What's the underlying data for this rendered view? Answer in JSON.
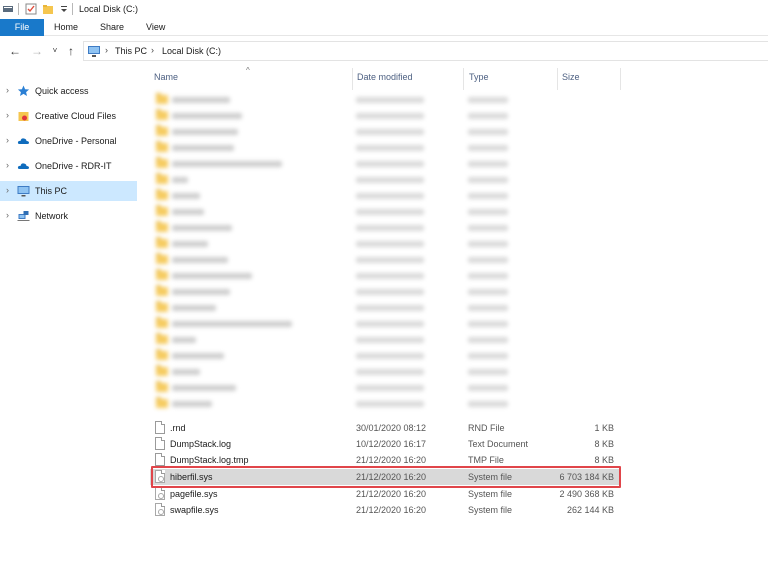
{
  "window": {
    "title": "Local Disk (C:)"
  },
  "ribbon": {
    "tabs": [
      "File",
      "Home",
      "Share",
      "View"
    ]
  },
  "address": {
    "segments": [
      "This PC",
      "Local Disk (C:)"
    ]
  },
  "sidebar": {
    "items": [
      {
        "label": "Quick access",
        "icon": "star-icon"
      },
      {
        "label": "Creative Cloud Files",
        "icon": "creative-cloud-folder-icon"
      },
      {
        "label": "OneDrive - Personal",
        "icon": "cloud-icon"
      },
      {
        "label": "OneDrive - RDR-IT",
        "icon": "cloud-icon"
      },
      {
        "label": "This PC",
        "icon": "computer-icon",
        "selected": true
      },
      {
        "label": "Network",
        "icon": "network-icon"
      }
    ]
  },
  "columns": {
    "name": "Name",
    "date": "Date modified",
    "type": "Type",
    "size": "Size"
  },
  "files": [
    {
      "name": ".rnd",
      "date": "30/01/2020 08:12",
      "type": "RND File",
      "size": "1 KB",
      "icon": "file-icon"
    },
    {
      "name": "DumpStack.log",
      "date": "10/12/2020 16:17",
      "type": "Text Document",
      "size": "8 KB",
      "icon": "file-icon"
    },
    {
      "name": "DumpStack.log.tmp",
      "date": "21/12/2020 16:20",
      "type": "TMP File",
      "size": "8 KB",
      "icon": "file-icon"
    },
    {
      "name": "hiberfil.sys",
      "date": "21/12/2020 16:20",
      "type": "System file",
      "size": "6 703 184 KB",
      "icon": "system-file-icon",
      "selected": true
    },
    {
      "name": "pagefile.sys",
      "date": "21/12/2020 16:20",
      "type": "System file",
      "size": "2 490 368 KB",
      "icon": "system-file-icon"
    },
    {
      "name": "swapfile.sys",
      "date": "21/12/2020 16:20",
      "type": "System file",
      "size": "262 144 KB",
      "icon": "system-file-icon"
    }
  ],
  "colors": {
    "accent": "#1979ca",
    "selection": "#cce8ff",
    "highlight_border": "#e0454a"
  }
}
